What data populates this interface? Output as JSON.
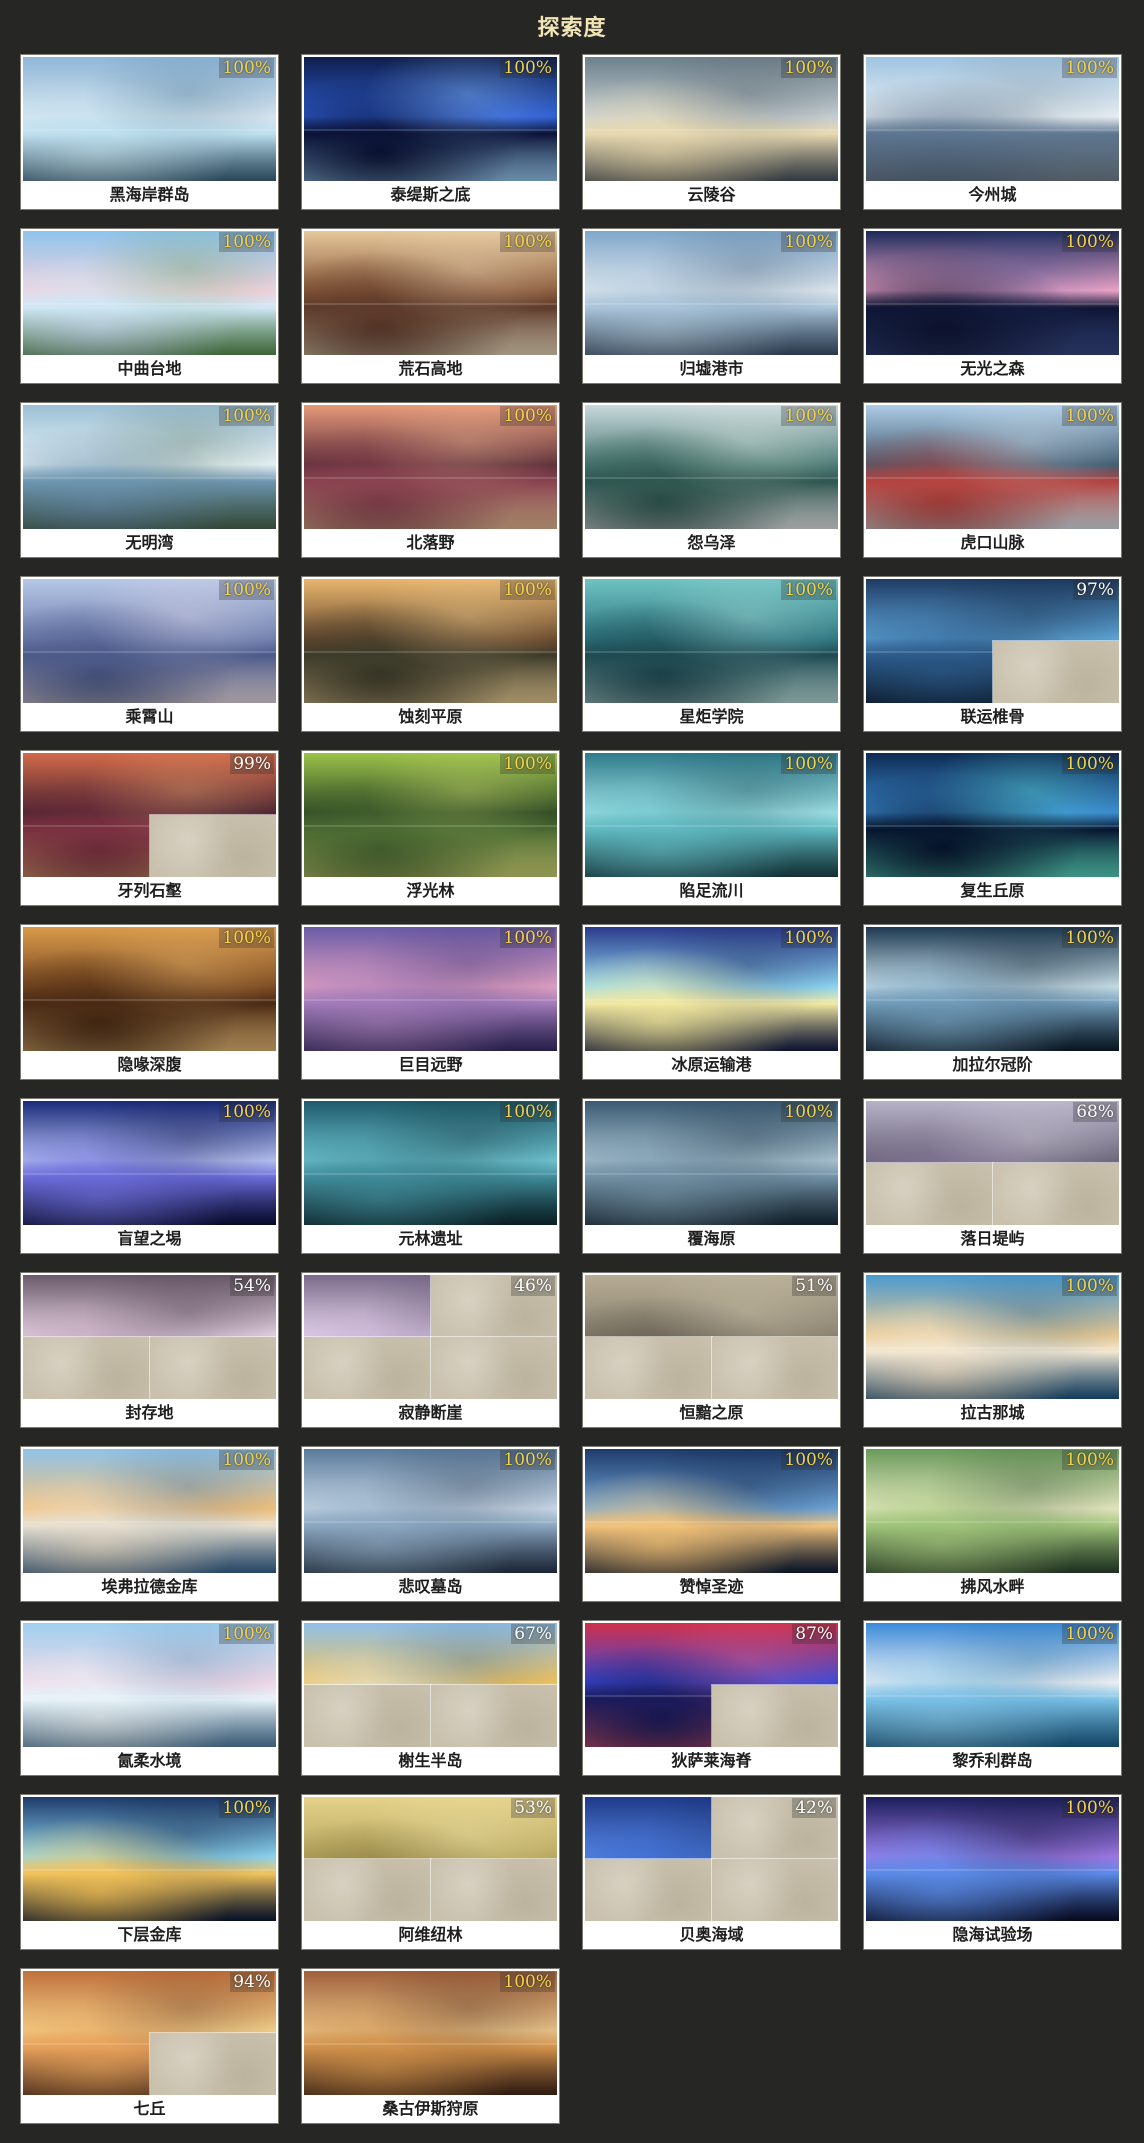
{
  "page": {
    "title": "探索度"
  },
  "regions": [
    {
      "name": "黑海岸群岛",
      "progress": "100%",
      "complete": true,
      "palette": [
        "#8fb6d8",
        "#d8e6f0",
        "#3e6c88",
        "#bfe0ef"
      ]
    },
    {
      "name": "泰缇斯之底",
      "progress": "100%",
      "complete": true,
      "palette": [
        "#0e1d4a",
        "#2f5fd4",
        "#9fd4ff",
        "#0a1236"
      ]
    },
    {
      "name": "云陵谷",
      "progress": "100%",
      "complete": true,
      "palette": [
        "#6c7f8a",
        "#c7d0d3",
        "#4c5660",
        "#e8d9b0"
      ]
    },
    {
      "name": "今州城",
      "progress": "100%",
      "complete": true,
      "palette": [
        "#9fc3e0",
        "#e9f0f4",
        "#7a8a98",
        "#5d7590"
      ]
    },
    {
      "name": "中曲台地",
      "progress": "100%",
      "complete": true,
      "palette": [
        "#8ec4ec",
        "#f2d2dd",
        "#5d9a55",
        "#cfe7f6"
      ]
    },
    {
      "name": "荒石高地",
      "progress": "100%",
      "complete": true,
      "palette": [
        "#e6c89b",
        "#8a5b3c",
        "#f4e2c4",
        "#5e3a2a"
      ]
    },
    {
      "name": "归墟港市",
      "progress": "100%",
      "complete": true,
      "palette": [
        "#7fa6c9",
        "#dfe8ef",
        "#3f5873",
        "#a9c3d8"
      ]
    },
    {
      "name": "无光之森",
      "progress": "100%",
      "complete": true,
      "palette": [
        "#1c2a5a",
        "#f0a5c8",
        "#3a4c8c",
        "#0e1534"
      ]
    },
    {
      "name": "无明湾",
      "progress": "100%",
      "complete": true,
      "palette": [
        "#9cc0d6",
        "#e8f2f6",
        "#4f6e55",
        "#6d95b0"
      ]
    },
    {
      "name": "北落野",
      "progress": "100%",
      "complete": true,
      "palette": [
        "#e79a7a",
        "#5d2f3a",
        "#f3c39b",
        "#8a4250"
      ]
    },
    {
      "name": "怨乌泽",
      "progress": "100%",
      "complete": true,
      "palette": [
        "#c9d9dc",
        "#4b7a72",
        "#eef3f2",
        "#2f5650"
      ]
    },
    {
      "name": "虎口山脉",
      "progress": "100%",
      "complete": true,
      "palette": [
        "#aecde6",
        "#3f5a70",
        "#e7f0f6",
        "#b5433f"
      ]
    },
    {
      "name": "乘霄山",
      "progress": "100%",
      "complete": true,
      "palette": [
        "#b7c7e6",
        "#6f7fae",
        "#f3e6ef",
        "#4c5a8a"
      ]
    },
    {
      "name": "蚀刻平原",
      "progress": "100%",
      "complete": true,
      "palette": [
        "#e8b66e",
        "#6a4a2e",
        "#f5d89c",
        "#3d3b2a"
      ]
    },
    {
      "name": "星炬学院",
      "progress": "100%",
      "complete": true,
      "palette": [
        "#6fc3c2",
        "#2e7680",
        "#bfe8e4",
        "#1f4a52"
      ]
    },
    {
      "name": "联运椎骨",
      "progress": "97%",
      "complete": false,
      "palette": [
        "#1e3b63",
        "#5fa6d8",
        "#0e1f38",
        "#2c5a8a"
      ]
    },
    {
      "name": "牙列石壑",
      "progress": "99%",
      "complete": false,
      "palette": [
        "#d26a4a",
        "#4a2430",
        "#f3b37a",
        "#7a3040"
      ]
    },
    {
      "name": "浮光林",
      "progress": "100%",
      "complete": true,
      "palette": [
        "#9cc24a",
        "#2f4a24",
        "#d8e27a",
        "#4a6a32"
      ]
    },
    {
      "name": "陷足流川",
      "progress": "100%",
      "complete": true,
      "palette": [
        "#2f7a8a",
        "#9fe0e6",
        "#1a4a50",
        "#5fb8c0"
      ]
    },
    {
      "name": "复生丘原",
      "progress": "100%",
      "complete": true,
      "palette": [
        "#0e2a52",
        "#3a8acf",
        "#5ce0c8",
        "#06152e"
      ]
    },
    {
      "name": "隐喙深腹",
      "progress": "100%",
      "complete": true,
      "palette": [
        "#d99a4a",
        "#7a4a22",
        "#f2c27a",
        "#4a2a14"
      ]
    },
    {
      "name": "巨目远野",
      "progress": "100%",
      "complete": true,
      "palette": [
        "#6a5aa6",
        "#e0a0c0",
        "#3a3070",
        "#a07ab8"
      ]
    },
    {
      "name": "冰原运输港",
      "progress": "100%",
      "complete": true,
      "palette": [
        "#2a3a8a",
        "#8fd8f4",
        "#141c4a",
        "#f2e8a0"
      ]
    },
    {
      "name": "加拉尔冠阶",
      "progress": "100%",
      "complete": true,
      "palette": [
        "#1e3a52",
        "#c9dfe8",
        "#0e2030",
        "#6f9ab8"
      ]
    },
    {
      "name": "盲望之埸",
      "progress": "100%",
      "complete": true,
      "palette": [
        "#1a2a7a",
        "#b7c2f2",
        "#0a1040",
        "#6a6ad8"
      ]
    },
    {
      "name": "元林遗址",
      "progress": "100%",
      "complete": true,
      "palette": [
        "#1e5a6a",
        "#6fc3d0",
        "#0e2e36",
        "#3f8a98"
      ]
    },
    {
      "name": "覆海原",
      "progress": "100%",
      "complete": true,
      "palette": [
        "#3a5a72",
        "#a8c2d0",
        "#1a2e3e",
        "#6f8ea2"
      ]
    },
    {
      "name": "落日堤屿",
      "progress": "68%",
      "complete": false,
      "palette": [
        "#b7b2c8",
        "#6a6478",
        "#e6e2ee",
        "#8a7aa0"
      ]
    },
    {
      "name": "封存地",
      "progress": "54%",
      "complete": false,
      "palette": [
        "#6a5a6a",
        "#e2cfe0",
        "#3a2e3a",
        "#b79ab0"
      ]
    },
    {
      "name": "寂静断崖",
      "progress": "46%",
      "complete": false,
      "palette": [
        "#7a6a8a",
        "#e6d6ec",
        "#3a3048",
        "#b7a0c8"
      ]
    },
    {
      "name": "恒黯之原",
      "progress": "51%",
      "complete": false,
      "palette": [
        "#b7ad95",
        "#8a8270",
        "#d8d0b8",
        "#5a5448"
      ]
    },
    {
      "name": "拉古那城",
      "progress": "100%",
      "complete": true,
      "palette": [
        "#4a9ad0",
        "#e8c890",
        "#1e5a8a",
        "#f2e6d0"
      ]
    },
    {
      "name": "埃弗拉德金库",
      "progress": "100%",
      "complete": true,
      "palette": [
        "#8fc3e8",
        "#f2c07a",
        "#3a6a9a",
        "#e8e0d0"
      ]
    },
    {
      "name": "悲叹墓岛",
      "progress": "100%",
      "complete": true,
      "palette": [
        "#5a7a9a",
        "#c9d8e6",
        "#2a3a52",
        "#8aa6c0"
      ]
    },
    {
      "name": "赞悼圣迹",
      "progress": "100%",
      "complete": true,
      "palette": [
        "#1e3a6a",
        "#6fa6d8",
        "#0e1e3a",
        "#f2c27a"
      ]
    },
    {
      "name": "拂风水畔",
      "progress": "100%",
      "complete": true,
      "palette": [
        "#6a9a5a",
        "#e6e8c0",
        "#2e4a30",
        "#9fc37a"
      ]
    },
    {
      "name": "氤柔水境",
      "progress": "100%",
      "complete": true,
      "palette": [
        "#9fd0f0",
        "#f2d8e6",
        "#5a8ab0",
        "#e6f2f8"
      ]
    },
    {
      "name": "榭生半岛",
      "progress": "67%",
      "complete": false,
      "palette": [
        "#8fbfe8",
        "#f2c25a",
        "#3a6a9a",
        "#d8e8f4"
      ]
    },
    {
      "name": "狄萨莱海脊",
      "progress": "87%",
      "complete": false,
      "palette": [
        "#d0304a",
        "#3a4ad8",
        "#f2607a",
        "#1a1a5a"
      ]
    },
    {
      "name": "黎乔利群岛",
      "progress": "100%",
      "complete": true,
      "palette": [
        "#3a8ad8",
        "#f2f2f4",
        "#1e6a9a",
        "#7ac0e6"
      ]
    },
    {
      "name": "下层金库",
      "progress": "100%",
      "complete": true,
      "palette": [
        "#1e3a6a",
        "#8fd8f2",
        "#0a1a3a",
        "#f2c25a"
      ]
    },
    {
      "name": "阿维纽林",
      "progress": "53%",
      "complete": false,
      "palette": [
        "#e6d28a",
        "#b7a860",
        "#f4eab8",
        "#8a7a40"
      ]
    },
    {
      "name": "贝奥海域",
      "progress": "42%",
      "complete": false,
      "palette": [
        "#1e3a8a",
        "#5a8ae6",
        "#0a1a4a",
        "#2e5ac0"
      ]
    },
    {
      "name": "隐海试验场",
      "progress": "100%",
      "complete": true,
      "palette": [
        "#1a1e5a",
        "#a07ae6",
        "#0a0e30",
        "#5a8ae6"
      ]
    },
    {
      "name": "七丘",
      "progress": "94%",
      "complete": false,
      "palette": [
        "#c0703a",
        "#f2d08a",
        "#5a3020",
        "#e6a05a"
      ]
    },
    {
      "name": "桑古伊斯狩原",
      "progress": "100%",
      "complete": true,
      "palette": [
        "#a0603a",
        "#e6c28a",
        "#4a2a1a",
        "#d0904a"
      ]
    }
  ],
  "fog": {
    "联运椎骨": [
      "br"
    ],
    "牙列石壑": [
      "br"
    ],
    "落日堤屿": [
      "bl",
      "br"
    ],
    "封存地": [
      "bl",
      "br"
    ],
    "寂静断崖": [
      "tr",
      "bl",
      "br"
    ],
    "恒黯之原": [
      "bl",
      "br"
    ],
    "榭生半岛": [
      "bl",
      "br"
    ],
    "狄萨莱海脊": [
      "br"
    ],
    "阿维纽林": [
      "bl",
      "br"
    ],
    "贝奥海域": [
      "tr",
      "bl",
      "br"
    ],
    "七丘": [
      "br"
    ]
  }
}
